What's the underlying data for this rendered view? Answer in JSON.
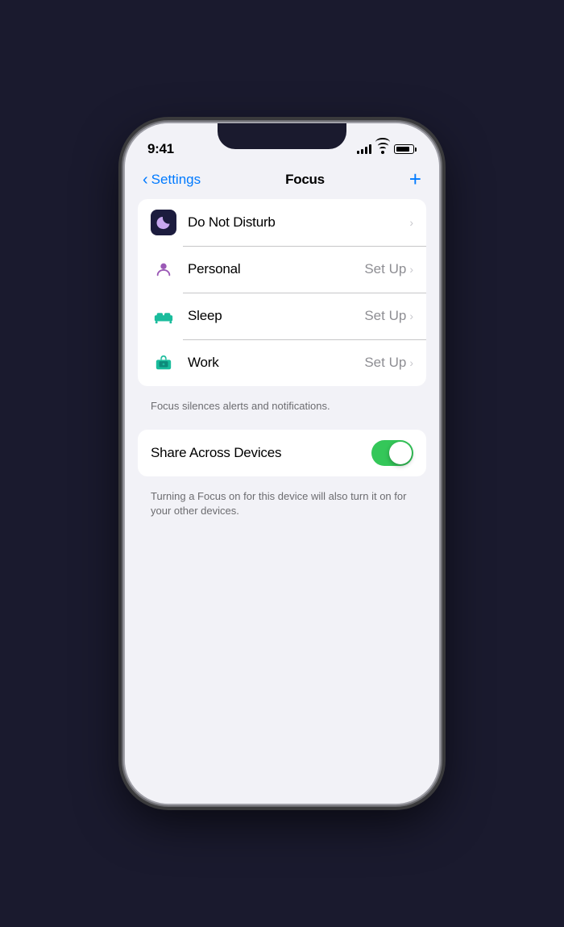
{
  "statusBar": {
    "time": "9:41"
  },
  "navBar": {
    "backLabel": "Settings",
    "title": "Focus",
    "addLabel": "+"
  },
  "focusItems": [
    {
      "id": "do-not-disturb",
      "label": "Do Not Disturb",
      "setupLabel": "",
      "hasSetUp": false,
      "iconType": "dnd"
    },
    {
      "id": "personal",
      "label": "Personal",
      "setupLabel": "Set Up",
      "hasSetUp": true,
      "iconType": "personal"
    },
    {
      "id": "sleep",
      "label": "Sleep",
      "setupLabel": "Set Up",
      "hasSetUp": true,
      "iconType": "sleep"
    },
    {
      "id": "work",
      "label": "Work",
      "setupLabel": "Set Up",
      "hasSetUp": true,
      "iconType": "work"
    }
  ],
  "listDescription": "Focus silences alerts and notifications.",
  "shareToggle": {
    "label": "Share Across Devices",
    "enabled": true
  },
  "toggleDescription": "Turning a Focus on for this device will also turn it on for your other devices.",
  "colors": {
    "accent": "#007aff",
    "toggleGreen": "#34c759",
    "dndBackground": "#1c1c3e",
    "personalPurple": "#9b59b6",
    "sleepTeal": "#1abc9c",
    "workTeal": "#1abc9c"
  }
}
